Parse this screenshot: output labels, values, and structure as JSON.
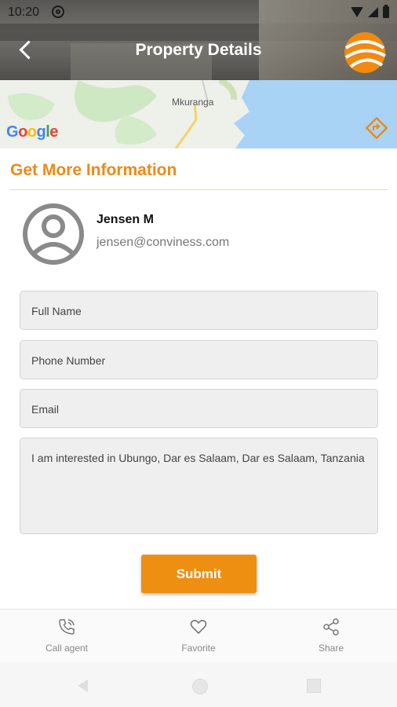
{
  "status_bar": {
    "time": "10:20"
  },
  "header": {
    "title": "Property Details"
  },
  "map": {
    "brand": "Google",
    "place_label": "Mkuranga"
  },
  "section": {
    "title": "Get More Information"
  },
  "agent": {
    "name": "Jensen M",
    "email": "jensen@conviness.com"
  },
  "form": {
    "full_name_placeholder": "Full Name",
    "phone_placeholder": "Phone Number",
    "email_placeholder": "Email",
    "message": "I am interested in Ubungo, Dar es Salaam, Dar es Salaam, Tanzania",
    "submit_label": "Submit"
  },
  "bottom_tabs": [
    {
      "label": "Call agent",
      "icon": "phone-icon"
    },
    {
      "label": "Favorite",
      "icon": "heart-icon"
    },
    {
      "label": "Share",
      "icon": "share-icon"
    }
  ],
  "colors": {
    "accent": "#ee8a17",
    "field_bg": "#efefef"
  }
}
